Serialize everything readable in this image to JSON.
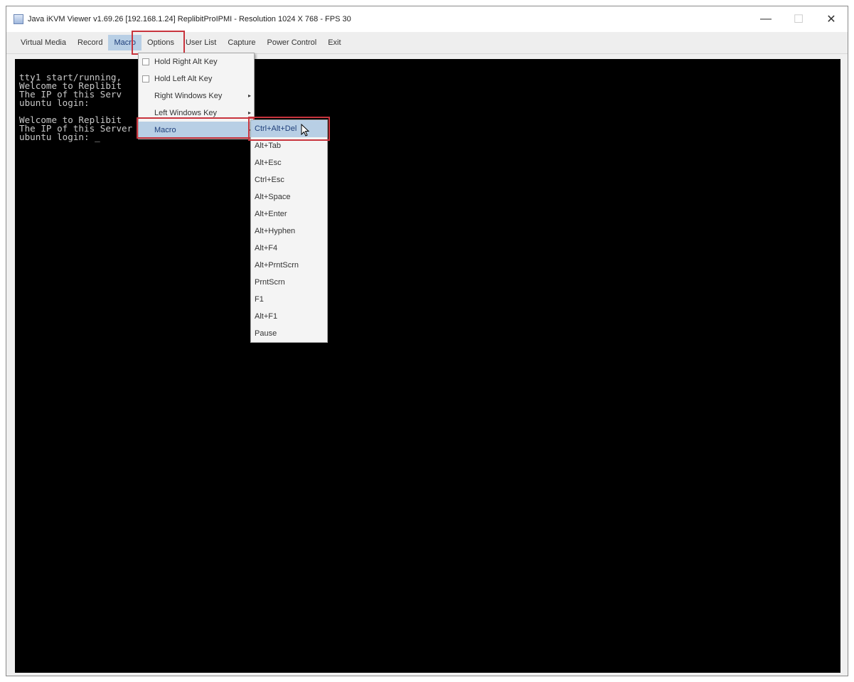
{
  "window": {
    "title": "Java iKVM Viewer v1.69.26 [192.168.1.24] ReplibitProIPMI - Resolution 1024 X 768 - FPS 30",
    "controls": {
      "minimize": "—",
      "maximize": "☐",
      "close": "✕"
    }
  },
  "menubar": {
    "items": [
      "Virtual Media",
      "Record",
      "Macro",
      "Options",
      "User List",
      "Capture",
      "Power Control",
      "Exit"
    ],
    "active": "Macro"
  },
  "console": {
    "lines": [
      "tty1 start/running,",
      "Welcome to Replibit",
      "The IP of this Serv",
      "ubuntu login:",
      "",
      "Welcome to Replibit",
      "The IP of this Server is: 192.168.1.",
      "ubuntu login: _"
    ]
  },
  "macro_menu": {
    "items": [
      {
        "label": "Hold Right Alt Key",
        "type": "checkbox",
        "checked": false
      },
      {
        "label": "Hold Left Alt Key",
        "type": "checkbox",
        "checked": false
      },
      {
        "label": "Right Windows Key",
        "type": "submenu"
      },
      {
        "label": "Left Windows Key",
        "type": "submenu"
      },
      {
        "label": "Macro",
        "type": "submenu",
        "selected": true
      }
    ]
  },
  "macro_submenu": {
    "items": [
      "Ctrl+Alt+Del",
      "Alt+Tab",
      "Alt+Esc",
      "Ctrl+Esc",
      "Alt+Space",
      "Alt+Enter",
      "Alt+Hyphen",
      "Alt+F4",
      "Alt+PrntScrn",
      "PrntScrn",
      "F1",
      "Alt+F1",
      "Pause"
    ],
    "selected": "Ctrl+Alt+Del"
  },
  "icons": {
    "app": "java-icon",
    "checkbox": "checkbox-icon",
    "submenu_arrow": "▸",
    "pointer": "mouse-pointer-icon"
  },
  "colors": {
    "highlight": "#b8cfe5",
    "callout": "#c8343d",
    "screen": "#000000"
  }
}
